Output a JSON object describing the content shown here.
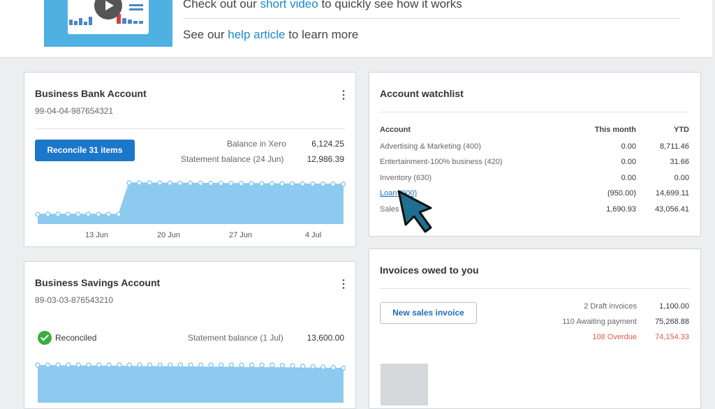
{
  "banner": {
    "video_prefix": "Check out our ",
    "video_link": "short video",
    "video_suffix": " to quickly see how it works",
    "help_prefix": "See our ",
    "help_link": "help article",
    "help_suffix": " to learn more"
  },
  "bank": {
    "title": "Business Bank Account",
    "number": "99-04-04-987654321",
    "reconcile_label": "Reconcile 31 items",
    "balance_xero_label": "Balance in Xero",
    "balance_xero_value": "6,124.25",
    "statement_label": "Statement balance (24 Jun)",
    "statement_value": "12,986.39",
    "axis": [
      "13 Jun",
      "20 Jun",
      "27 Jun",
      "4 Jul"
    ]
  },
  "savings": {
    "title": "Business Savings Account",
    "number": "89-03-03-876543210",
    "status": "Reconciled",
    "statement_label": "Statement balance (1 Jul)",
    "statement_value": "13,600.00"
  },
  "watchlist": {
    "title": "Account watchlist",
    "col_account": "Account",
    "col_month": "This month",
    "col_ytd": "YTD",
    "rows": [
      {
        "name": "Advertising & Marketing (400)",
        "month": "0.00",
        "ytd": "8,711.46"
      },
      {
        "name": "Entertainment-100% business (420)",
        "month": "0.00",
        "ytd": "31.66"
      },
      {
        "name": "Inventory (630)",
        "month": "0.00",
        "ytd": "0.00"
      },
      {
        "name": "Loan (900)",
        "month": "(950.00)",
        "ytd": "14,699.11"
      },
      {
        "name": "Sales",
        "month": "1,690.93",
        "ytd": "43,056.41"
      }
    ]
  },
  "invoices": {
    "title": "Invoices owed to you",
    "new_label": "New sales invoice",
    "draft_label": "2 Draft invoices",
    "draft_value": "1,100.00",
    "awaiting_label": "110 Awaiting payment",
    "awaiting_value": "75,268.88",
    "overdue_label": "108 Overdue",
    "overdue_value": "74,154.33"
  },
  "colors": {
    "accent": "#1a77c9",
    "chart_fill": "#8dcaef",
    "overdue": "#e0584a",
    "reconciled": "#3aae3f"
  }
}
